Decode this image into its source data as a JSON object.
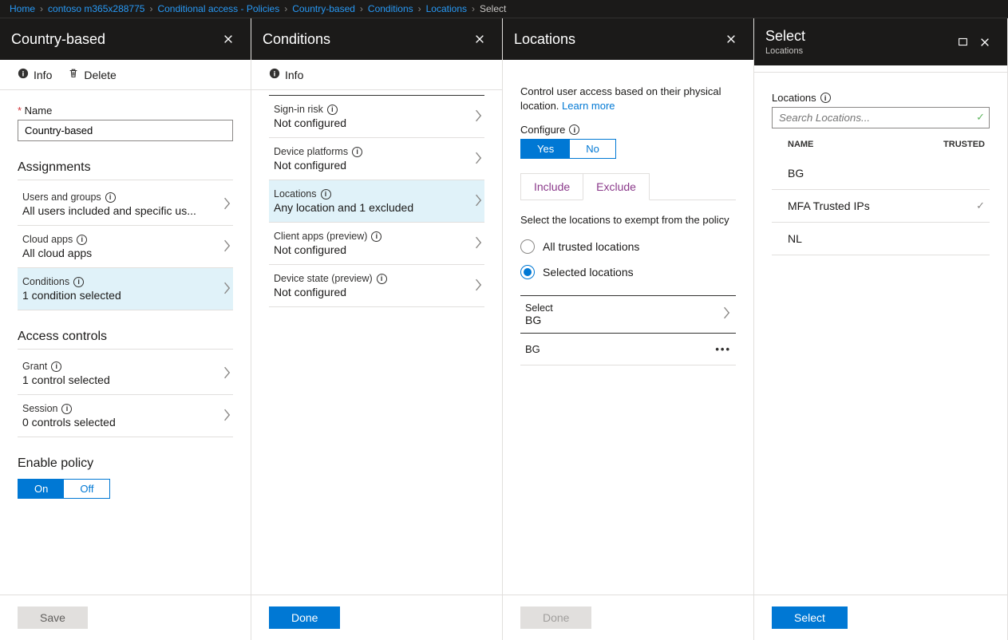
{
  "breadcrumbs": [
    {
      "label": "Home",
      "link": true
    },
    {
      "label": "contoso m365x288775",
      "link": true
    },
    {
      "label": "Conditional access - Policies",
      "link": true
    },
    {
      "label": "Country-based",
      "link": true
    },
    {
      "label": "Conditions",
      "link": true
    },
    {
      "label": "Locations",
      "link": true
    },
    {
      "label": "Select",
      "link": false
    }
  ],
  "blade0": {
    "title": "Country-based",
    "cmd_info": "Info",
    "cmd_delete": "Delete",
    "name_label": "Name",
    "name_value": "Country-based",
    "assignments_heading": "Assignments",
    "rows": [
      {
        "top": "Users and groups",
        "bot": "All users included and specific us...",
        "sel": false
      },
      {
        "top": "Cloud apps",
        "bot": "All cloud apps",
        "sel": false
      },
      {
        "top": "Conditions",
        "bot": "1 condition selected",
        "sel": true
      }
    ],
    "access_heading": "Access controls",
    "access_rows": [
      {
        "top": "Grant",
        "bot": "1 control selected"
      },
      {
        "top": "Session",
        "bot": "0 controls selected"
      }
    ],
    "enable_heading": "Enable policy",
    "on": "On",
    "off": "Off",
    "save": "Save"
  },
  "blade1": {
    "title": "Conditions",
    "cmd_info": "Info",
    "rows": [
      {
        "top": "Sign-in risk",
        "bot": "Not configured",
        "sel": false
      },
      {
        "top": "Device platforms",
        "bot": "Not configured",
        "sel": false
      },
      {
        "top": "Locations",
        "bot": "Any location and 1 excluded",
        "sel": true
      },
      {
        "top": "Client apps (preview)",
        "bot": "Not configured",
        "sel": false
      },
      {
        "top": "Device state (preview)",
        "bot": "Not configured",
        "sel": false
      }
    ],
    "done": "Done"
  },
  "blade2": {
    "title": "Locations",
    "desc": "Control user access based on their physical location. ",
    "learn": "Learn more",
    "configure": "Configure",
    "yes": "Yes",
    "no": "No",
    "tab_include": "Include",
    "tab_exclude": "Exclude",
    "instruction": "Select the locations to exempt from the policy",
    "radio_all": "All trusted locations",
    "radio_sel": "Selected locations",
    "select_label": "Select",
    "select_value": "BG",
    "chips": [
      "BG"
    ],
    "done": "Done"
  },
  "blade3": {
    "title": "Select",
    "subtitle": "Locations",
    "list_label": "Locations",
    "search_placeholder": "Search Locations...",
    "col_name": "NAME",
    "col_trusted": "TRUSTED",
    "items": [
      {
        "name": "BG",
        "trusted": false
      },
      {
        "name": "MFA Trusted IPs",
        "trusted": true
      },
      {
        "name": "NL",
        "trusted": false
      }
    ],
    "select": "Select"
  }
}
